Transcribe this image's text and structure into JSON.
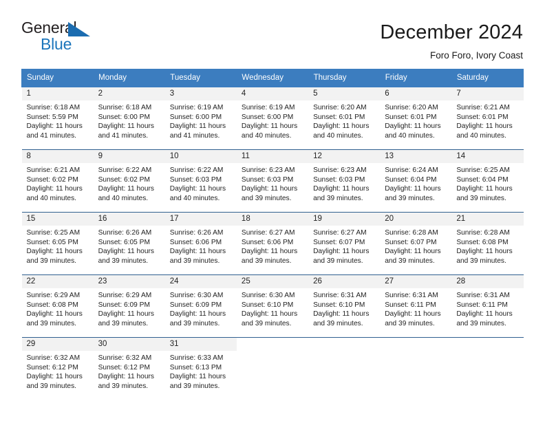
{
  "logo": {
    "word_top": "General",
    "word_bottom": "Blue",
    "triangle_icon": "triangle-icon",
    "accent_color": "#1b75bb"
  },
  "header": {
    "title": "December 2024",
    "subtitle": "Foro Foro, Ivory Coast"
  },
  "calendar": {
    "header_bg": "#3c7dbf",
    "daynum_bg": "#f2f2f2",
    "weekdays": [
      "Sunday",
      "Monday",
      "Tuesday",
      "Wednesday",
      "Thursday",
      "Friday",
      "Saturday"
    ],
    "labels": {
      "sunrise": "Sunrise:",
      "sunset": "Sunset:",
      "daylight": "Daylight:"
    },
    "weeks": [
      [
        {
          "day": "1",
          "sunrise": "Sunrise: 6:18 AM",
          "sunset": "Sunset: 5:59 PM",
          "daylight1": "Daylight: 11 hours",
          "daylight2": "and 41 minutes."
        },
        {
          "day": "2",
          "sunrise": "Sunrise: 6:18 AM",
          "sunset": "Sunset: 6:00 PM",
          "daylight1": "Daylight: 11 hours",
          "daylight2": "and 41 minutes."
        },
        {
          "day": "3",
          "sunrise": "Sunrise: 6:19 AM",
          "sunset": "Sunset: 6:00 PM",
          "daylight1": "Daylight: 11 hours",
          "daylight2": "and 41 minutes."
        },
        {
          "day": "4",
          "sunrise": "Sunrise: 6:19 AM",
          "sunset": "Sunset: 6:00 PM",
          "daylight1": "Daylight: 11 hours",
          "daylight2": "and 40 minutes."
        },
        {
          "day": "5",
          "sunrise": "Sunrise: 6:20 AM",
          "sunset": "Sunset: 6:01 PM",
          "daylight1": "Daylight: 11 hours",
          "daylight2": "and 40 minutes."
        },
        {
          "day": "6",
          "sunrise": "Sunrise: 6:20 AM",
          "sunset": "Sunset: 6:01 PM",
          "daylight1": "Daylight: 11 hours",
          "daylight2": "and 40 minutes."
        },
        {
          "day": "7",
          "sunrise": "Sunrise: 6:21 AM",
          "sunset": "Sunset: 6:01 PM",
          "daylight1": "Daylight: 11 hours",
          "daylight2": "and 40 minutes."
        }
      ],
      [
        {
          "day": "8",
          "sunrise": "Sunrise: 6:21 AM",
          "sunset": "Sunset: 6:02 PM",
          "daylight1": "Daylight: 11 hours",
          "daylight2": "and 40 minutes."
        },
        {
          "day": "9",
          "sunrise": "Sunrise: 6:22 AM",
          "sunset": "Sunset: 6:02 PM",
          "daylight1": "Daylight: 11 hours",
          "daylight2": "and 40 minutes."
        },
        {
          "day": "10",
          "sunrise": "Sunrise: 6:22 AM",
          "sunset": "Sunset: 6:03 PM",
          "daylight1": "Daylight: 11 hours",
          "daylight2": "and 40 minutes."
        },
        {
          "day": "11",
          "sunrise": "Sunrise: 6:23 AM",
          "sunset": "Sunset: 6:03 PM",
          "daylight1": "Daylight: 11 hours",
          "daylight2": "and 39 minutes."
        },
        {
          "day": "12",
          "sunrise": "Sunrise: 6:23 AM",
          "sunset": "Sunset: 6:03 PM",
          "daylight1": "Daylight: 11 hours",
          "daylight2": "and 39 minutes."
        },
        {
          "day": "13",
          "sunrise": "Sunrise: 6:24 AM",
          "sunset": "Sunset: 6:04 PM",
          "daylight1": "Daylight: 11 hours",
          "daylight2": "and 39 minutes."
        },
        {
          "day": "14",
          "sunrise": "Sunrise: 6:25 AM",
          "sunset": "Sunset: 6:04 PM",
          "daylight1": "Daylight: 11 hours",
          "daylight2": "and 39 minutes."
        }
      ],
      [
        {
          "day": "15",
          "sunrise": "Sunrise: 6:25 AM",
          "sunset": "Sunset: 6:05 PM",
          "daylight1": "Daylight: 11 hours",
          "daylight2": "and 39 minutes."
        },
        {
          "day": "16",
          "sunrise": "Sunrise: 6:26 AM",
          "sunset": "Sunset: 6:05 PM",
          "daylight1": "Daylight: 11 hours",
          "daylight2": "and 39 minutes."
        },
        {
          "day": "17",
          "sunrise": "Sunrise: 6:26 AM",
          "sunset": "Sunset: 6:06 PM",
          "daylight1": "Daylight: 11 hours",
          "daylight2": "and 39 minutes."
        },
        {
          "day": "18",
          "sunrise": "Sunrise: 6:27 AM",
          "sunset": "Sunset: 6:06 PM",
          "daylight1": "Daylight: 11 hours",
          "daylight2": "and 39 minutes."
        },
        {
          "day": "19",
          "sunrise": "Sunrise: 6:27 AM",
          "sunset": "Sunset: 6:07 PM",
          "daylight1": "Daylight: 11 hours",
          "daylight2": "and 39 minutes."
        },
        {
          "day": "20",
          "sunrise": "Sunrise: 6:28 AM",
          "sunset": "Sunset: 6:07 PM",
          "daylight1": "Daylight: 11 hours",
          "daylight2": "and 39 minutes."
        },
        {
          "day": "21",
          "sunrise": "Sunrise: 6:28 AM",
          "sunset": "Sunset: 6:08 PM",
          "daylight1": "Daylight: 11 hours",
          "daylight2": "and 39 minutes."
        }
      ],
      [
        {
          "day": "22",
          "sunrise": "Sunrise: 6:29 AM",
          "sunset": "Sunset: 6:08 PM",
          "daylight1": "Daylight: 11 hours",
          "daylight2": "and 39 minutes."
        },
        {
          "day": "23",
          "sunrise": "Sunrise: 6:29 AM",
          "sunset": "Sunset: 6:09 PM",
          "daylight1": "Daylight: 11 hours",
          "daylight2": "and 39 minutes."
        },
        {
          "day": "24",
          "sunrise": "Sunrise: 6:30 AM",
          "sunset": "Sunset: 6:09 PM",
          "daylight1": "Daylight: 11 hours",
          "daylight2": "and 39 minutes."
        },
        {
          "day": "25",
          "sunrise": "Sunrise: 6:30 AM",
          "sunset": "Sunset: 6:10 PM",
          "daylight1": "Daylight: 11 hours",
          "daylight2": "and 39 minutes."
        },
        {
          "day": "26",
          "sunrise": "Sunrise: 6:31 AM",
          "sunset": "Sunset: 6:10 PM",
          "daylight1": "Daylight: 11 hours",
          "daylight2": "and 39 minutes."
        },
        {
          "day": "27",
          "sunrise": "Sunrise: 6:31 AM",
          "sunset": "Sunset: 6:11 PM",
          "daylight1": "Daylight: 11 hours",
          "daylight2": "and 39 minutes."
        },
        {
          "day": "28",
          "sunrise": "Sunrise: 6:31 AM",
          "sunset": "Sunset: 6:11 PM",
          "daylight1": "Daylight: 11 hours",
          "daylight2": "and 39 minutes."
        }
      ],
      [
        {
          "day": "29",
          "sunrise": "Sunrise: 6:32 AM",
          "sunset": "Sunset: 6:12 PM",
          "daylight1": "Daylight: 11 hours",
          "daylight2": "and 39 minutes."
        },
        {
          "day": "30",
          "sunrise": "Sunrise: 6:32 AM",
          "sunset": "Sunset: 6:12 PM",
          "daylight1": "Daylight: 11 hours",
          "daylight2": "and 39 minutes."
        },
        {
          "day": "31",
          "sunrise": "Sunrise: 6:33 AM",
          "sunset": "Sunset: 6:13 PM",
          "daylight1": "Daylight: 11 hours",
          "daylight2": "and 39 minutes."
        },
        {
          "day": "",
          "sunrise": "",
          "sunset": "",
          "daylight1": "",
          "daylight2": ""
        },
        {
          "day": "",
          "sunrise": "",
          "sunset": "",
          "daylight1": "",
          "daylight2": ""
        },
        {
          "day": "",
          "sunrise": "",
          "sunset": "",
          "daylight1": "",
          "daylight2": ""
        },
        {
          "day": "",
          "sunrise": "",
          "sunset": "",
          "daylight1": "",
          "daylight2": ""
        }
      ]
    ]
  }
}
